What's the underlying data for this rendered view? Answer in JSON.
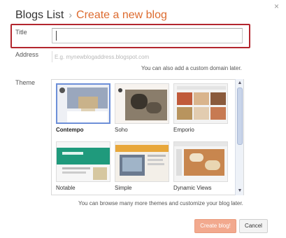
{
  "dialog": {
    "close_glyph": "×",
    "breadcrumb": {
      "parent": "Blogs List",
      "separator": "›",
      "current": "Create a new blog"
    }
  },
  "form": {
    "title_label": "Title",
    "title_value": "",
    "address_label": "Address",
    "address_placeholder": "E.g. mynewblogaddress.blogspot.com",
    "address_hint": "You can also add a custom domain later.",
    "theme_label": "Theme"
  },
  "themes": [
    {
      "name": "Contempo",
      "selected": true
    },
    {
      "name": "Soho",
      "selected": false
    },
    {
      "name": "Emporio",
      "selected": false
    },
    {
      "name": "Notable",
      "selected": false
    },
    {
      "name": "Simple",
      "selected": false
    },
    {
      "name": "Dynamic Views",
      "selected": false
    }
  ],
  "theme_hint": "You can browse many more themes and customize your blog later.",
  "scrollbar": {
    "up_icon": "▲",
    "down_icon": "▼"
  },
  "buttons": {
    "create": "Create blog!",
    "cancel": "Cancel"
  },
  "colors": {
    "accent": "#dd6b2f",
    "highlight_border": "#b3262e",
    "create_button": "#f2a98e",
    "selected_theme_border": "#6d8fd8"
  }
}
